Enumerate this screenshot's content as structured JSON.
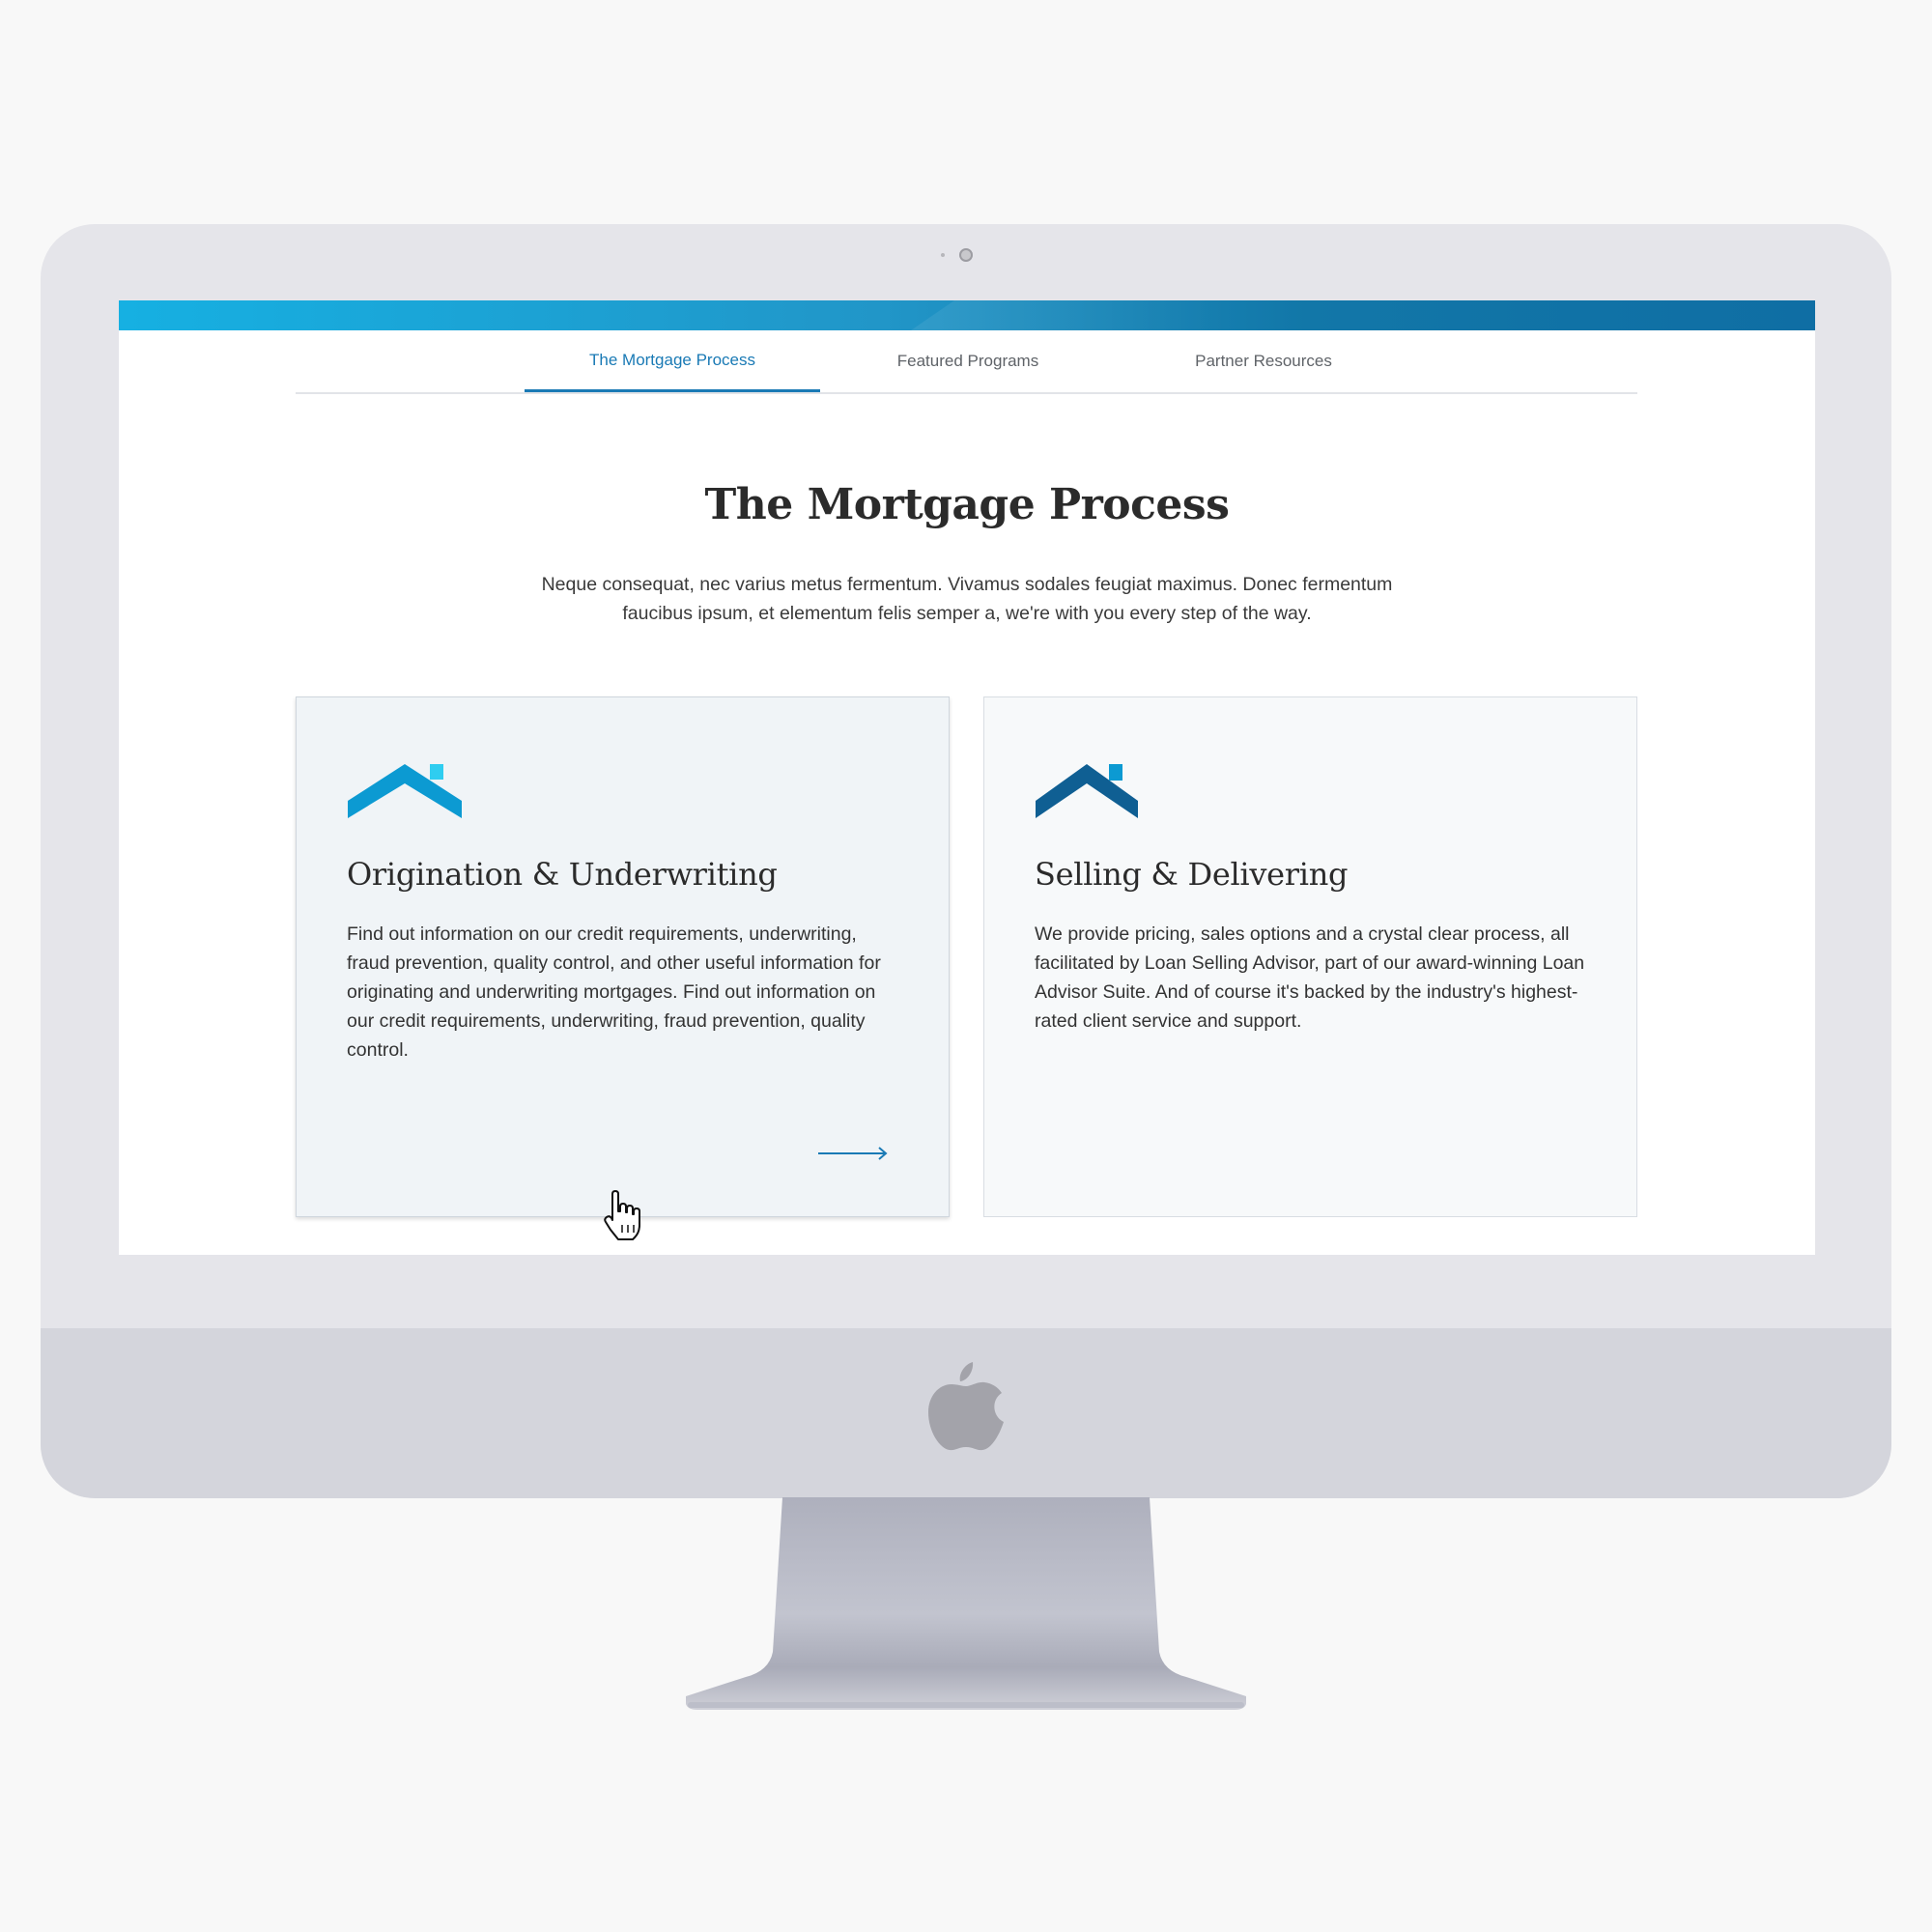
{
  "colors": {
    "accent": "#1a7ab5",
    "header_gradient_start": "#16b0e2",
    "header_gradient_end": "#0f6ea4",
    "icon_light_blue": "#0c9ad2",
    "icon_dark_blue": "#0f5f93"
  },
  "tabs": [
    {
      "label": "The Mortgage Process",
      "active": true
    },
    {
      "label": "Featured Programs",
      "active": false
    },
    {
      "label": "Partner Resources",
      "active": false
    }
  ],
  "main": {
    "title": "The Mortgage Process",
    "intro": "Neque consequat, nec varius metus fermentum. Vivamus sodales feugiat maximus. Donec fermentum faucibus ipsum, et elementum felis semper a, we're with you every step of the way."
  },
  "cards": [
    {
      "icon": "house-roof-icon",
      "title": "Origination & Underwriting",
      "text": "Find out information on our credit requirements, underwriting, fraud prevention, quality control, and other useful information for originating and underwriting mortgages. Find out information on our credit requirements, underwriting, fraud prevention, quality control.",
      "link_icon": "arrow-right-icon",
      "hovered": true
    },
    {
      "icon": "house-roof-icon",
      "title": "Selling & Delivering",
      "text": "We provide pricing, sales options and a crystal clear process, all facilitated by Loan Selling Advisor, part of our award-winning Loan Advisor Suite. And of course it's backed by the industry's highest-rated client service and support."
    }
  ],
  "device": {
    "frame": "imac",
    "logo_icon": "apple-logo-icon",
    "pointer_icon": "hand-cursor-icon"
  }
}
